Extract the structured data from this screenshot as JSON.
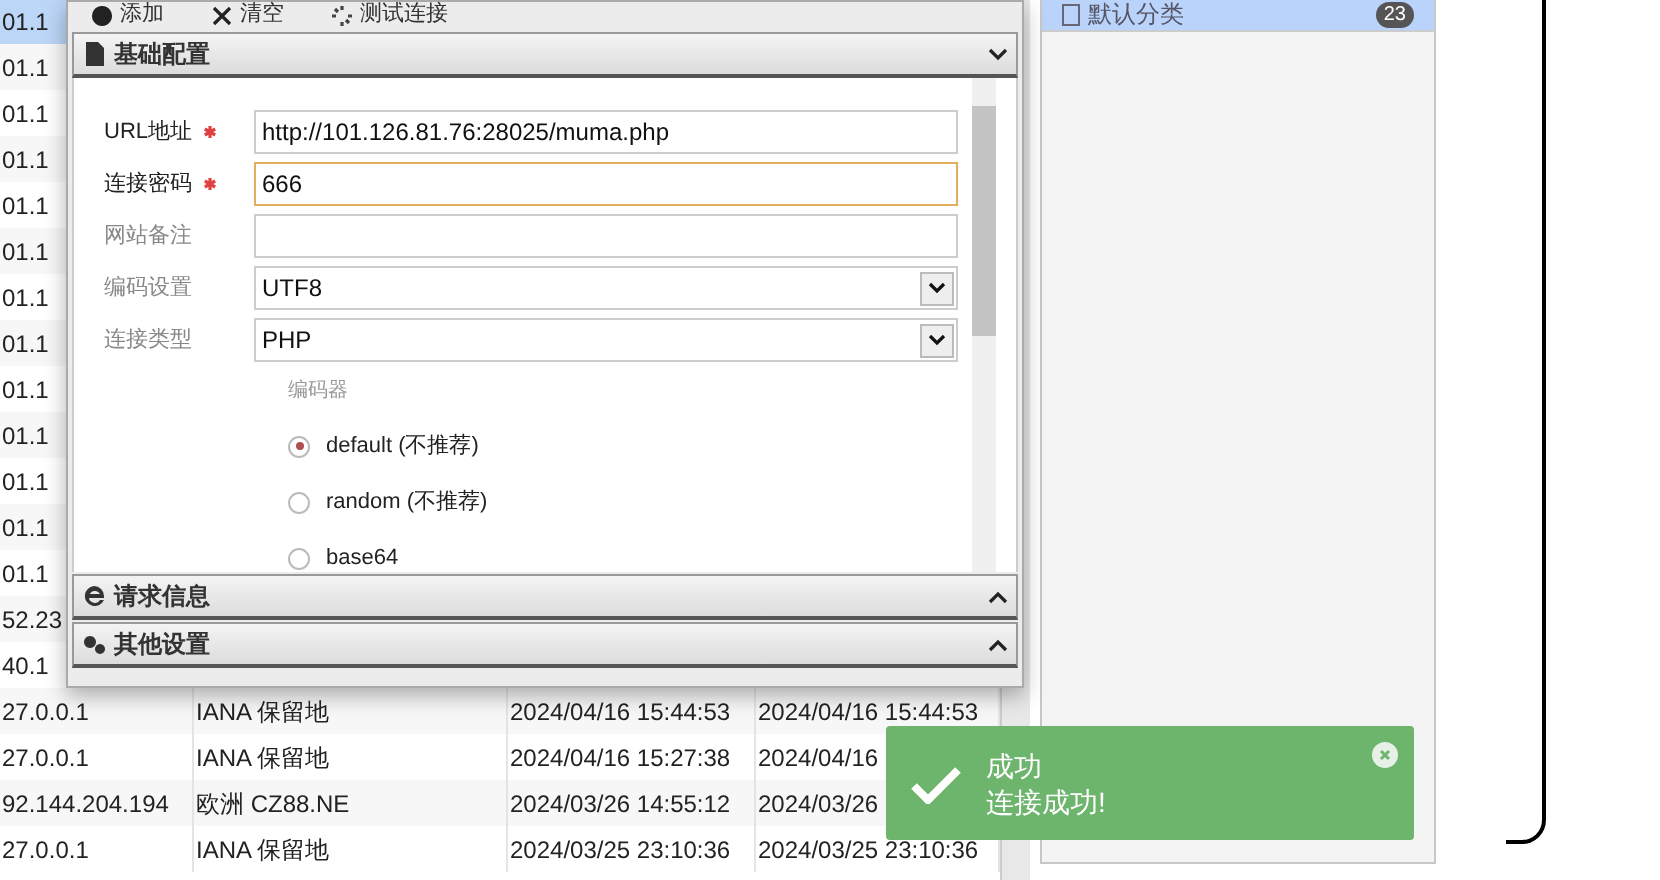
{
  "table": {
    "rows": [
      {
        "column_1": "01.1",
        "selected": true
      },
      {
        "column_1": "01.1",
        "selected": false
      },
      {
        "column_1": "01.1",
        "selected": false
      },
      {
        "column_1": "01.1",
        "selected": false
      },
      {
        "column_1": "01.1",
        "selected": false
      },
      {
        "column_1": "01.1",
        "selected": false
      },
      {
        "column_1": "01.1",
        "selected": false
      },
      {
        "column_1": "01.1",
        "selected": false
      },
      {
        "column_1": "01.1",
        "selected": false
      },
      {
        "column_1": "01.1",
        "selected": false
      },
      {
        "column_1": "01.1",
        "selected": false
      },
      {
        "column_1": "01.1",
        "selected": false
      },
      {
        "column_1": "01.1",
        "selected": false
      },
      {
        "column_1": "52.23",
        "selected": false
      },
      {
        "column_1": "40.1",
        "selected": false
      },
      {
        "column_1": "27.0.0.1",
        "column_2": "IANA 保留地",
        "column_3": "2024/04/16 15:44:53",
        "column_4": "2024/04/16 15:44:53",
        "selected": false
      },
      {
        "column_1": "27.0.0.1",
        "column_2": "IANA 保留地",
        "column_3": "2024/04/16 15:27:38",
        "column_4": "2024/04/16",
        "selected": false
      },
      {
        "column_1": "92.144.204.194",
        "column_2": "欧洲 CZ88.NE",
        "column_3": "2024/03/26 14:55:12",
        "column_4": "2024/03/26",
        "selected": false
      },
      {
        "column_1": "27.0.0.1",
        "column_2": "IANA 保留地",
        "column_3": "2024/03/25 23:10:36",
        "column_4": "2024/03/25 23:10:36",
        "selected": false
      }
    ]
  },
  "sidebar": {
    "items": [
      {
        "label": "默认分类",
        "count": "23",
        "selected": true
      }
    ]
  },
  "dialog": {
    "toolbar": [
      {
        "label": "添加",
        "kind": "add"
      },
      {
        "label": "清空",
        "kind": "clear"
      },
      {
        "label": "测试连接",
        "kind": "test"
      }
    ],
    "sections": [
      {
        "title": "基础配置",
        "kind": "doc",
        "expanded": true
      },
      {
        "title": "请求信息",
        "kind": "web",
        "expanded": false
      },
      {
        "title": "其他设置",
        "kind": "gears",
        "expanded": false
      }
    ],
    "fields": [
      {
        "label": "URL地址",
        "kind": "text",
        "required": true,
        "focused": false,
        "value": "http://101.126.81.76:28025/muma.php"
      },
      {
        "label": "连接密码",
        "kind": "text",
        "required": true,
        "focused": true,
        "value": "666"
      },
      {
        "label": "网站备注",
        "kind": "text",
        "required": false,
        "focused": false
      },
      {
        "label": "编码设置",
        "kind": "select",
        "required": false,
        "focused": false,
        "value": "UTF8"
      },
      {
        "label": "连接类型",
        "kind": "select",
        "required": false,
        "focused": false,
        "value": "PHP"
      }
    ],
    "encoder": {
      "label": "编码器",
      "options": [
        {
          "label": "default (不推荐)",
          "selected": true
        },
        {
          "label": "random (不推荐)",
          "selected": false
        },
        {
          "label": "base64",
          "selected": false
        }
      ]
    }
  },
  "toast": {
    "title": "成功",
    "message": "连接成功!"
  }
}
